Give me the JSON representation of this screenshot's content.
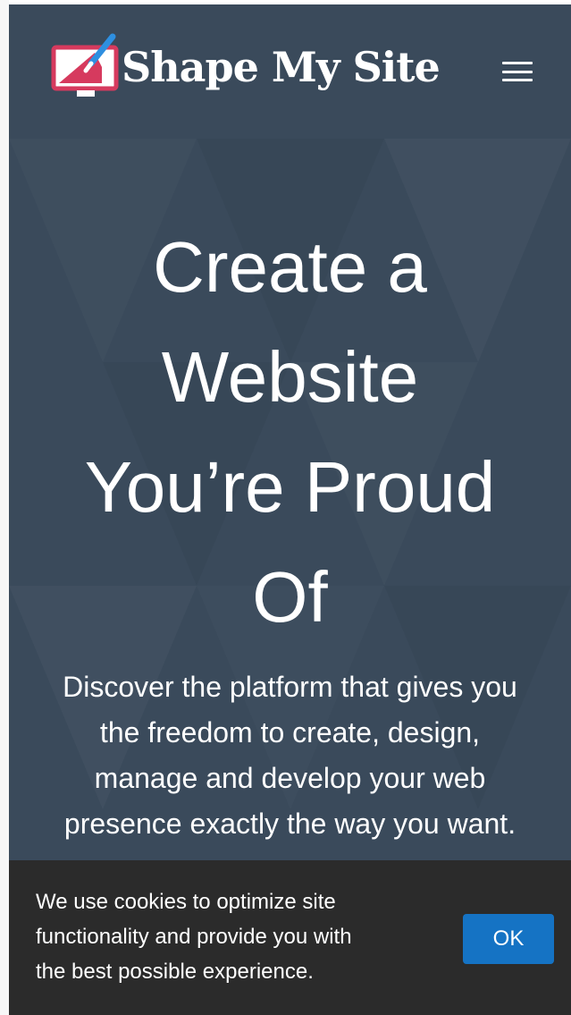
{
  "header": {
    "logo_text": "Shape My Site",
    "logo_icon": "monitor-paintbrush-icon",
    "menu_icon": "hamburger-menu-icon"
  },
  "hero": {
    "headline_lines": [
      "Create a",
      "Website",
      "You’re Proud",
      "Of"
    ],
    "subtext_lines": [
      "Discover the platform that gives you",
      "the freedom to create, design,",
      "manage and develop your web",
      "presence exactly the way you want."
    ]
  },
  "cookie_banner": {
    "text_lines": [
      "We use cookies to optimize site",
      "functionality and provide you with",
      "the best possible experience."
    ],
    "ok_label": "OK"
  },
  "colors": {
    "hero_background": "#3a4a5b",
    "cookie_background": "#2b2b2b",
    "ok_button": "#1573c4",
    "logo_accent": "#d63a5e",
    "text": "#ffffff"
  }
}
